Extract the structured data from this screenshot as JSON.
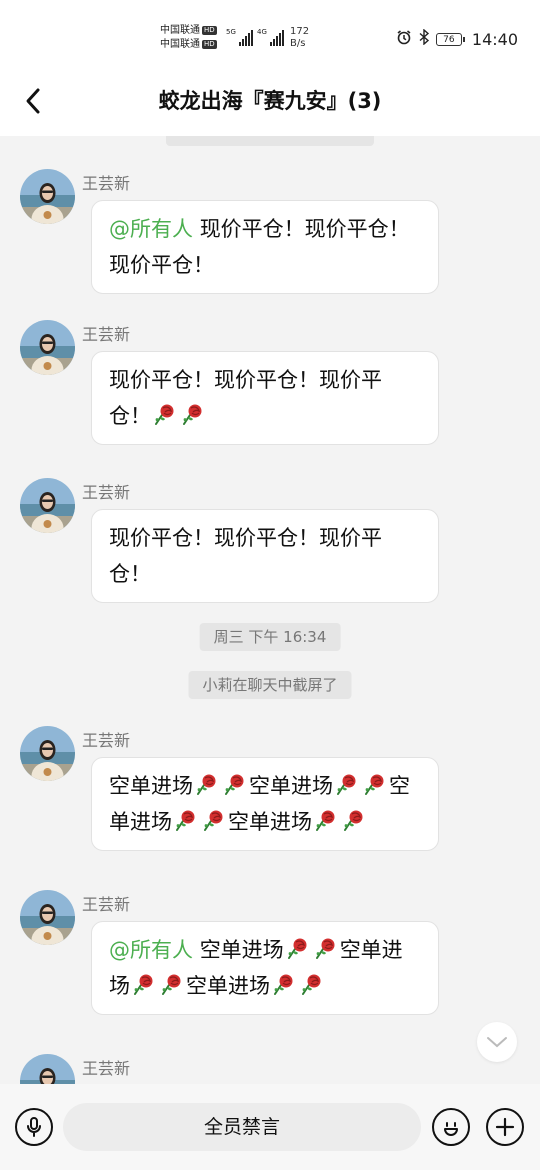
{
  "status_bar": {
    "carrier_1": "中国联通",
    "carrier_2": "中国联通",
    "hd_badge": "HD",
    "sim1_network": "5G",
    "sim2_network": "4G",
    "net_speed_value": "172",
    "net_speed_unit": "B/s",
    "battery": "76",
    "time": "14:40"
  },
  "header": {
    "title": "蛟龙出海『赛九安』(3)",
    "back_icon": "chevron-left-icon"
  },
  "chat": {
    "messages": [
      {
        "sender": "王芸新",
        "mention": "@所有人",
        "text": "现价平仓！现价平仓！现价平仓！"
      },
      {
        "sender": "王芸新",
        "text": "现价平仓！现价平仓！现价平仓！",
        "trailing_roses": 2
      },
      {
        "sender": "王芸新",
        "text": "现价平仓！现价平仓！现价平仓！"
      },
      {
        "sender": "王芸新",
        "text": "空单进场🌹🌹空单进场🌹🌹空单进场🌹🌹空单进场🌹🌹"
      },
      {
        "sender": "王芸新",
        "mention": "@所有人",
        "text": "空单进场🌹🌹空单进场🌹🌹空单进场🌹🌹"
      },
      {
        "sender": "王芸新"
      }
    ],
    "timestamp": "周三 下午 16:34",
    "screenshot_notice": "小莉在聊天中截屏了",
    "rose_icon": "rose-emoji-icon",
    "scroll_down_icon": "chevron-down-icon"
  },
  "input_bar": {
    "voice_icon": "microphone-icon",
    "muted_label": "全员禁言",
    "emoji_icon": "smiley-icon",
    "plus_icon": "plus-icon"
  },
  "colors": {
    "mention": "#4caf50",
    "background": "#f3f3f3",
    "bubble": "#ffffff"
  }
}
